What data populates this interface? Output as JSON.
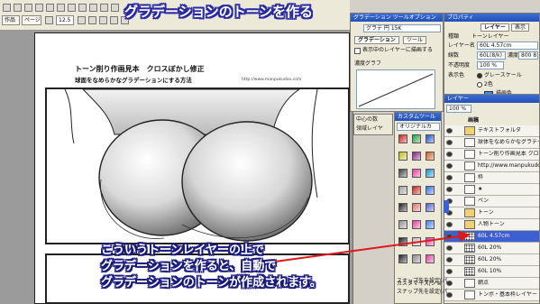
{
  "banner": "グラデーションのトーンを作る",
  "callout": {
    "lines": [
      "こういうトーンレイヤーの上で",
      "グラデーションを作ると、自動で",
      "グラデーションのトーンが作成されます。"
    ]
  },
  "toolbar": {
    "menu_sakuhin": "作品",
    "menu_page": "ページ",
    "zoom": "12.5"
  },
  "document": {
    "title": "トーン削り作画見本　クロスぼかし修正",
    "subtitle": "球面をなめらかなグラデーションにする方法",
    "url": "http://www.manpukudou.com"
  },
  "gradation_panel": {
    "title": "グラデーション ツールオプション",
    "preset": "グラデ 円 15K",
    "tab": "グラデーション",
    "tab2": "ツール",
    "check_label": "表示中のレイヤーに描画する",
    "graph_label": "濃度グラフ"
  },
  "custom_panel": {
    "title": "カスタムツール",
    "field": "オリジナルカ",
    "customize": "カスタマイズ/ショートカ"
  },
  "property_panel": {
    "title": "プロパティ",
    "tab_layer": "レイヤー",
    "tab_other": "表示",
    "kind_label": "種類",
    "kind_value": "トーンレイヤー",
    "layer_name_label": "レイヤー名",
    "layer_name_value": "60L 4.57cm",
    "lines_label": "線数",
    "lines_value": "60L(8/k)",
    "density_label": "濃度",
    "density_value": "800 8",
    "opacity_label": "不透明度",
    "opacity_value": "100 %",
    "display_label": "表示色",
    "display_value": "グレースケール",
    "display_alt": "2色",
    "color_name": "描画色"
  },
  "layer_panel": {
    "title": "レイヤー",
    "opacity": "100 %",
    "mode": "画稿",
    "rows": [
      {
        "name": "テキストフォルダ",
        "type": "folder",
        "selected": false
      },
      {
        "name": "球体をなめらかなグラデー",
        "type": "text",
        "selected": false
      },
      {
        "name": "トーン削り作画見本 クロ",
        "type": "text",
        "selected": false
      },
      {
        "name": "http://www.manpukudou",
        "type": "text",
        "selected": false
      },
      {
        "name": "枠",
        "type": "layer",
        "selected": false
      },
      {
        "name": "★",
        "type": "layer",
        "selected": false
      },
      {
        "name": "ペン",
        "type": "layer",
        "selected": false
      },
      {
        "name": "トーン",
        "type": "folder",
        "selected": false
      },
      {
        "name": "人物トーン",
        "type": "folder",
        "selected": false
      },
      {
        "name": "60L 4.57cm",
        "type": "tone",
        "selected": true
      },
      {
        "name": "60L 20%",
        "type": "tone",
        "selected": false
      },
      {
        "name": "60L 20%",
        "type": "tone",
        "selected": false
      },
      {
        "name": "60L 10%",
        "type": "tone",
        "selected": false
      },
      {
        "name": "網点",
        "type": "layer",
        "selected": false
      },
      {
        "name": "トンボ・基本枠レイヤー",
        "type": "layer",
        "selected": false
      }
    ]
  },
  "snap": {
    "line1": "スナップ先を設定(パ",
    "line2": "スナップ先を設定(パ"
  },
  "colors": {
    "accent": "#2350b8",
    "callout_outline": "#1a1a7c",
    "arrow": "#e01818",
    "selected_layer": "#3c5fd1"
  }
}
